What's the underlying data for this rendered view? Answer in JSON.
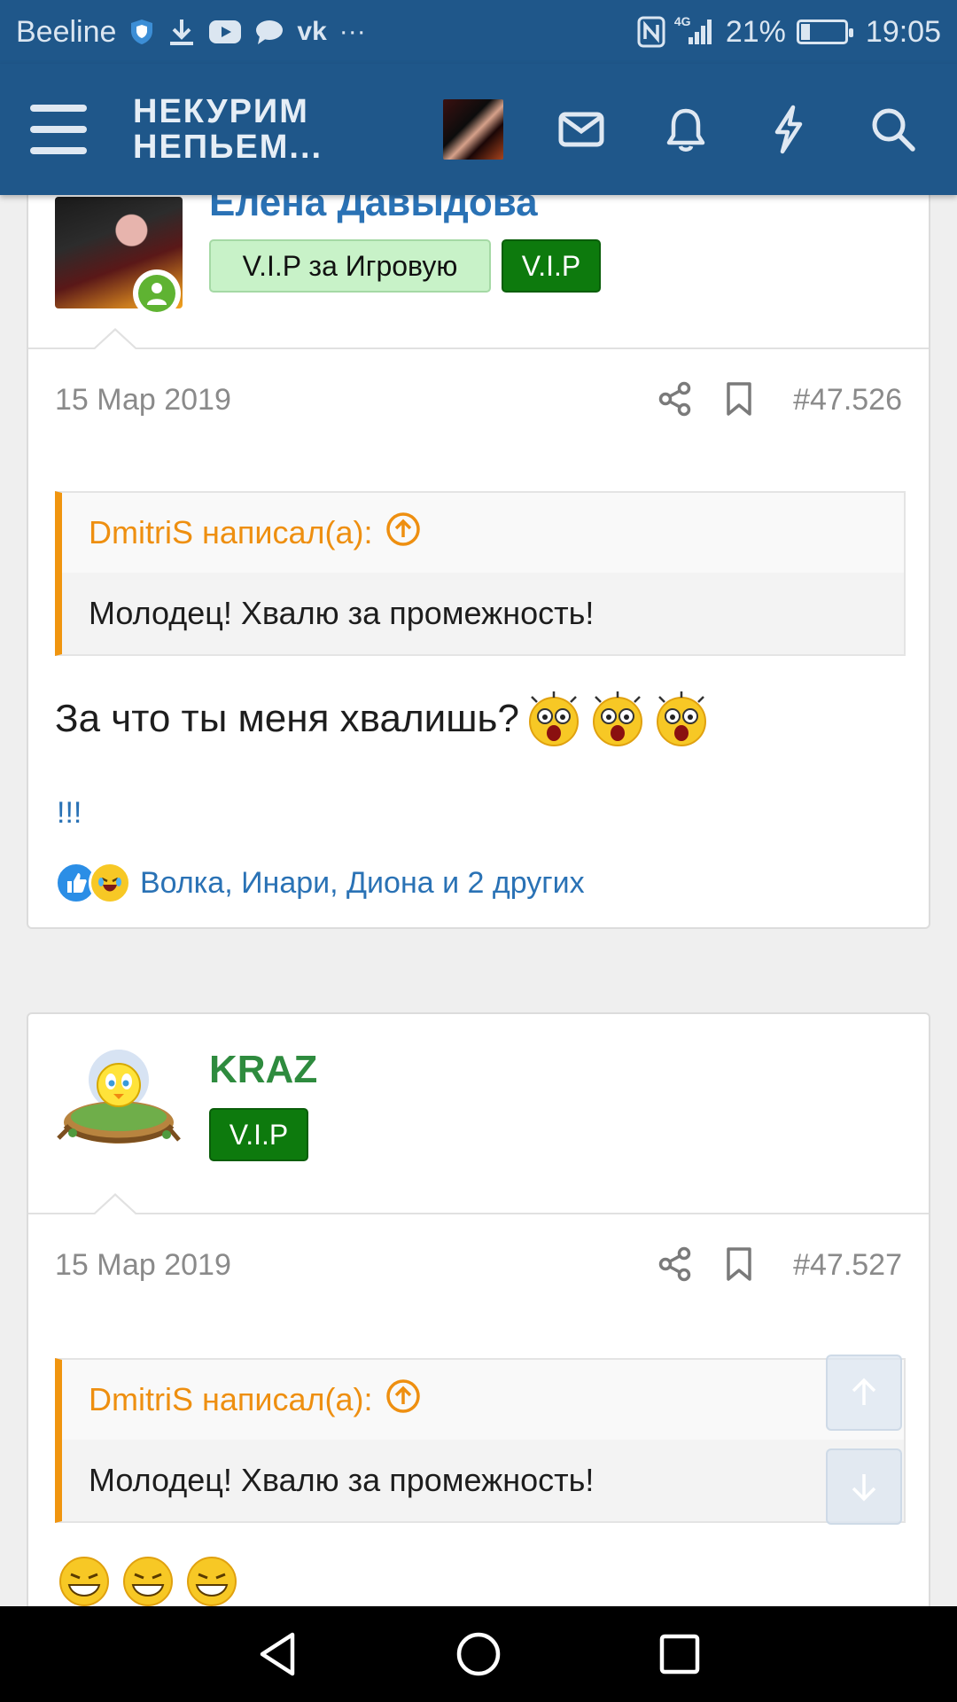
{
  "status_bar": {
    "carrier": "Beeline",
    "extra_dots": "···",
    "network_label": "4G",
    "battery_percent": "21%",
    "battery_level": 0.21,
    "time": "19:05"
  },
  "header": {
    "title_line1": "НЕКУРИМ",
    "title_line2": "НЕПЬЕМ...",
    "icons": [
      "menu-icon",
      "avatar",
      "mail-icon",
      "bell-icon",
      "lightning-icon",
      "search-icon"
    ]
  },
  "posts": [
    {
      "author": "Елена Давыдова",
      "author_color": "#2a72b5",
      "badges": [
        "V.I.P за Игровую",
        "V.I.P"
      ],
      "date": "15 Мар 2019",
      "post_number": "#47.526",
      "quote_author": "DmitriS написал(а):",
      "quote_text": "Молодец! Хвалю за промежность!",
      "text": "За что ты меня хвалишь?",
      "extra": "!!!",
      "reactions_text": "Волка, Инари, Диона и 2 других"
    },
    {
      "author": "KRAZ",
      "author_color": "#2e8b3e",
      "badges": [
        "V.I.P"
      ],
      "date": "15 Мар 2019",
      "post_number": "#47.527",
      "quote_author": "DmitriS написал(а):",
      "quote_text": "Молодец! Хвалю за промежность!"
    }
  ],
  "colors": {
    "header_bg": "#1f578a",
    "quote_accent": "#f0950f",
    "link": "#2a72b5",
    "vip_dark": "#0d7a0d",
    "vip_light": "#c8f2c8"
  }
}
